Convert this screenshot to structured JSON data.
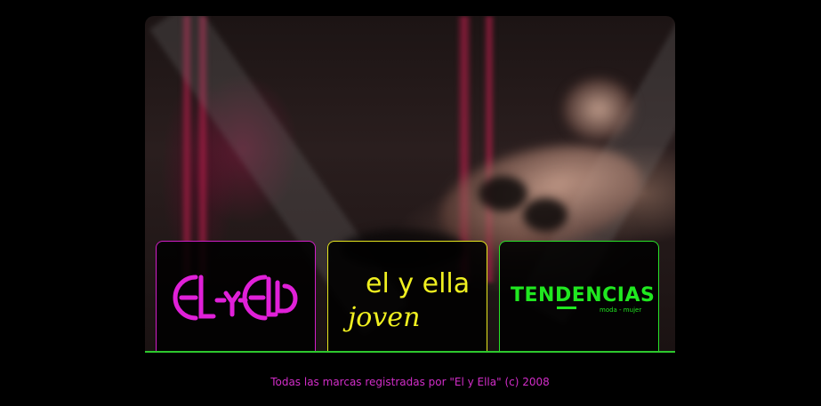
{
  "brands": [
    {
      "name": "El y Ella",
      "logo_text": "EL-Y-ELLA",
      "color": "#e020d8"
    },
    {
      "name": "el y ella joven",
      "logo_line1": "el y ella",
      "logo_line2": "joven",
      "color": "#f0f020"
    },
    {
      "name": "Tendencias",
      "logo_text": "TENDENCIAS",
      "logo_tagline": "moda - mujer",
      "color": "#20e820"
    }
  ],
  "footer": {
    "text": "Todas las marcas registradas por \"El y Ella\" (c) 2008"
  },
  "colors": {
    "background": "#000000",
    "accent_line": "#2ec82e",
    "footer_text": "#d22dc8"
  }
}
